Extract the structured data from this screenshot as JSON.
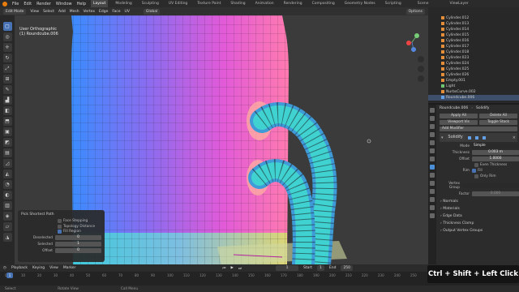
{
  "topbar": {
    "menus": [
      "File",
      "Edit",
      "Render",
      "Window",
      "Help"
    ],
    "workspaces": [
      "Layout",
      "Modeling",
      "Sculpting",
      "UV Editing",
      "Texture Paint",
      "Shading",
      "Animation",
      "Rendering",
      "Compositing",
      "Geometry Nodes",
      "Scripting"
    ],
    "active_workspace": "Layout",
    "scene": "Scene",
    "view_layer": "ViewLayer"
  },
  "header": {
    "mode": "Edit Mode",
    "menus": [
      "View",
      "Select",
      "Add",
      "Mesh",
      "Vertex",
      "Edge",
      "Face",
      "UV"
    ],
    "orientation": "Global",
    "options": "Options"
  },
  "viewport": {
    "view_name": "User Orthographic",
    "object_name": "(1) Roundcube.006"
  },
  "operator_panel": {
    "title": "Pick Shortest Path",
    "checkboxes": [
      {
        "label": "Face Stepping",
        "checked": false
      },
      {
        "label": "Topology Distance",
        "checked": false
      },
      {
        "label": "Fill Region",
        "checked": true
      }
    ],
    "fields": [
      {
        "label": "Deselected",
        "value": "0"
      },
      {
        "label": "Selected",
        "value": "1"
      },
      {
        "label": "Offset",
        "value": "0"
      }
    ]
  },
  "outliner": {
    "items": [
      "Cylinder.012",
      "Cylinder.013",
      "Cylinder.014",
      "Cylinder.015",
      "Cylinder.016",
      "Cylinder.017",
      "Cylinder.018",
      "Cylinder.023",
      "Cylinder.024",
      "Cylinder.025",
      "Cylinder.026",
      "Empty.001",
      "Light",
      "NurbsCurve.002",
      "Roundcube.006"
    ]
  },
  "properties": {
    "object": "Roundcube.006",
    "modifier_tab": "Solidify",
    "apply_all": "Apply All",
    "delete_all": "Delete All",
    "viewport_vis": "Viewport Vis",
    "toggle_stack": "Toggle Stack",
    "add_modifier": "Add Modifier",
    "modifier_name": "Solidify",
    "mode_label": "Mode",
    "mode_value": "Simple",
    "thickness_label": "Thickness",
    "thickness_value": "0.003 m",
    "offset_label": "Offset",
    "offset_value": "1.0000",
    "even_thickness": "Even Thickness",
    "rim_label": "Rim",
    "fill": "Fill",
    "only_rim": "Only Rim",
    "vertex_group": "Vertex Group",
    "factor_label": "Factor",
    "factor_value": "0.000",
    "sections": [
      "Normals",
      "Materials",
      "Edge Data",
      "Thickness Clamp",
      "Output Vertex Groups"
    ]
  },
  "timeline": {
    "menus": [
      "Playback",
      "Keying",
      "View",
      "Marker"
    ],
    "current_frame": "1",
    "start_label": "Start",
    "start": "1",
    "end_label": "End",
    "end": "250",
    "ticks": [
      "0",
      "10",
      "20",
      "30",
      "40",
      "50",
      "60",
      "70",
      "80",
      "90",
      "100",
      "110",
      "120",
      "130",
      "140",
      "150",
      "160",
      "170",
      "180",
      "190",
      "200",
      "210",
      "220",
      "230",
      "240",
      "250"
    ]
  },
  "statusbar": {
    "items": [
      "Select",
      "Rotate View",
      "Call Menu"
    ]
  },
  "key_overlay": "Ctrl + Shift + Left Click"
}
